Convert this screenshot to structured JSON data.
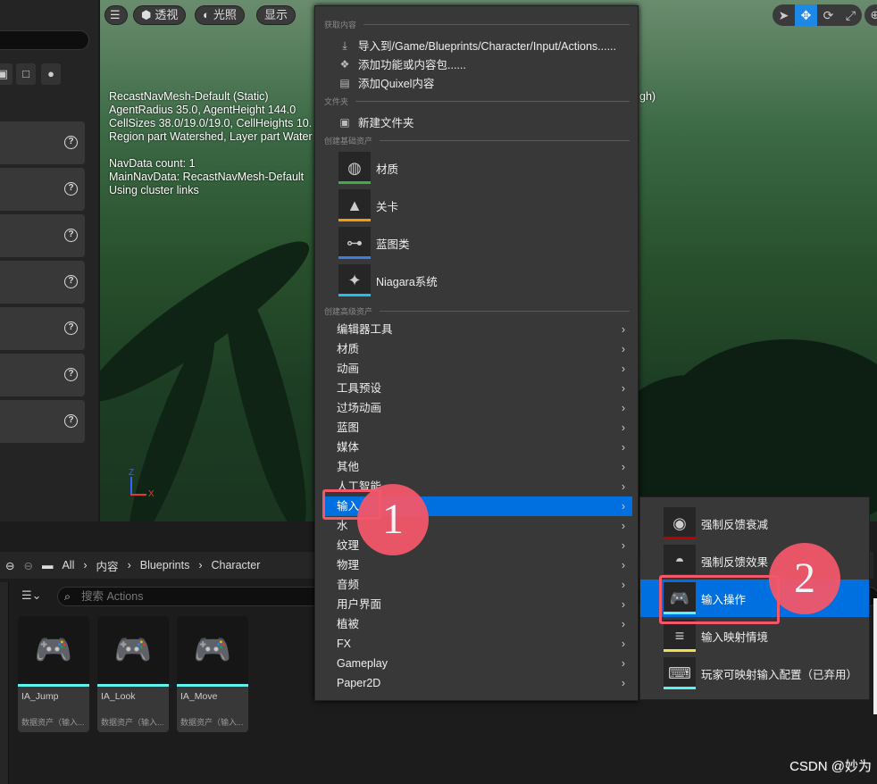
{
  "viewport": {
    "toolbar": {
      "menu": "☰",
      "perspective": "透视",
      "lighting": "光照",
      "show": "显示"
    },
    "nav_lines": [
      "RecastNavMesh-Default (Static)",
      "AgentRadius 35.0, AgentHeight 144.0",
      "CellSizes 38.0/19.0/19.0, CellHeights 10.",
      "Region part Watershed, Layer part Water",
      "",
      "NavData count: 1",
      "MainNavData: RecastNavMesh-Default",
      "Using cluster links"
    ],
    "right_fragment": "gh)",
    "axis": {
      "z": "Z",
      "x": "X"
    }
  },
  "menu": {
    "sections": {
      "get": "获取内容",
      "folder": "文件夹",
      "basic": "创建基础资产",
      "advanced": "创建高级资产"
    },
    "get_items": [
      {
        "label": "导入到/Game/Blueprints/Character/Input/Actions......",
        "icon": "import-icon"
      },
      {
        "label": "添加功能或内容包......",
        "icon": "add-pack-icon"
      },
      {
        "label": "添加Quixel内容",
        "icon": "quixel-icon"
      }
    ],
    "folder_item": {
      "label": "新建文件夹",
      "icon": "new-folder-icon"
    },
    "basic_items": [
      {
        "label": "材质",
        "color": "#3cb043",
        "icon": "material-icon"
      },
      {
        "label": "关卡",
        "color": "#f59b0a",
        "icon": "level-icon"
      },
      {
        "label": "蓝图类",
        "color": "#3d7de0",
        "icon": "blueprint-icon"
      },
      {
        "label": "Niagara系统",
        "color": "#1ec0f0",
        "icon": "niagara-icon"
      }
    ],
    "advanced_items": [
      "编辑器工具",
      "材质",
      "动画",
      "工具预设",
      "过场动画",
      "蓝图",
      "媒体",
      "其他",
      "人工智能",
      "输入",
      "水",
      "纹理",
      "物理",
      "音频",
      "用户界面",
      "植被",
      "FX",
      "Gameplay",
      "Paper2D"
    ],
    "highlighted": "输入"
  },
  "submenu": {
    "items": [
      {
        "label": "强制反馈衰减",
        "color": "#c00000"
      },
      {
        "label": "强制反馈效果",
        "color": "#c00000"
      },
      {
        "label": "输入操作",
        "color": "#5ff0f0"
      },
      {
        "label": "输入映射情境",
        "color": "#f0e050"
      },
      {
        "label": "玩家可映射输入配置（已弃用）",
        "color": "#5ff0f0"
      }
    ],
    "highlighted": "输入操作"
  },
  "annotations": {
    "one": "1",
    "two": "2",
    "color": "#f2576a"
  },
  "content_browser": {
    "breadcrumb": [
      "All",
      "内容",
      "Blueprints",
      "Character"
    ],
    "search_placeholder": "搜索 Actions",
    "assets": [
      {
        "name": "IA_Jump",
        "type": "数据资产（输入..."
      },
      {
        "name": "IA_Look",
        "type": "数据资产（输入..."
      },
      {
        "name": "IA_Move",
        "type": "数据资产（输入..."
      }
    ]
  },
  "watermark": "CSDN @妙为",
  "accent": "#0070e0"
}
